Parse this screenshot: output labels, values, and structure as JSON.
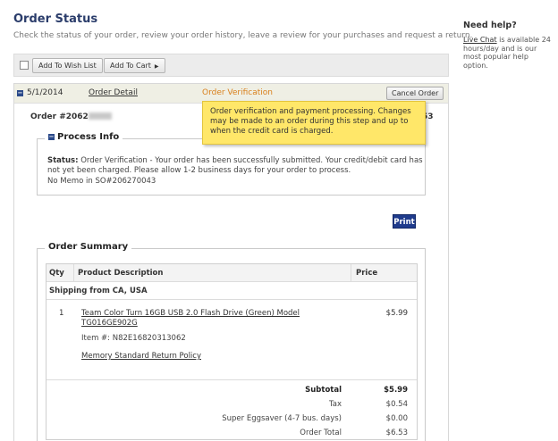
{
  "page": {
    "title": "Order Status",
    "subtitle": "Check the status of your order, review your order history, leave a review for your purchases and request a return."
  },
  "toolbar": {
    "wish_label": "Add To Wish List",
    "cart_label": "Add To Cart"
  },
  "order": {
    "date": "5/1/2014",
    "detail_label": "Order Detail",
    "step": "Order Verification",
    "cancel_label": "Cancel Order",
    "number_prefix": "Order #2062",
    "total_peek": "53"
  },
  "tooltip": {
    "text": "Order verification and payment processing. Changes may be made to an order during this step and up to when the credit card is charged."
  },
  "process": {
    "title": "Process Info",
    "status_label": "Status:",
    "status_text": "Order Verification - Your order has been successfully submitted. Your credit/debit card has not yet been charged. Please allow 1-2 business days for your order to process.",
    "memo": "No Memo in SO#206270043"
  },
  "print_label": "Print",
  "summary": {
    "title": "Order Summary",
    "headers": {
      "qty": "Qty",
      "desc": "Product Description",
      "price": "Price"
    },
    "shipping_from": "Shipping from CA, USA",
    "item": {
      "qty": "1",
      "name": "Team Color Turn 16GB USB 2.0 Flash Drive (Green) Model TG016GE902G",
      "item_no": "Item #: N82E16820313062",
      "policy": "Memory Standard Return Policy",
      "price": "$5.99"
    },
    "totals": [
      {
        "label": "Subtotal",
        "value": "$5.99"
      },
      {
        "label": "Tax",
        "value": "$0.54"
      },
      {
        "label": "Super Eggsaver (4-7 bus. days)",
        "value": "$0.00"
      },
      {
        "label": "Order Total",
        "value": "$6.53"
      }
    ]
  },
  "help": {
    "title": "Need help?",
    "link": "Live Chat",
    "text": " is available 24 hours/day and is our most popular help option."
  },
  "colors": {
    "title": "#2b3d6b",
    "step": "#d9801c",
    "tooltip": "#ffe769",
    "print": "#1f3b8c"
  }
}
